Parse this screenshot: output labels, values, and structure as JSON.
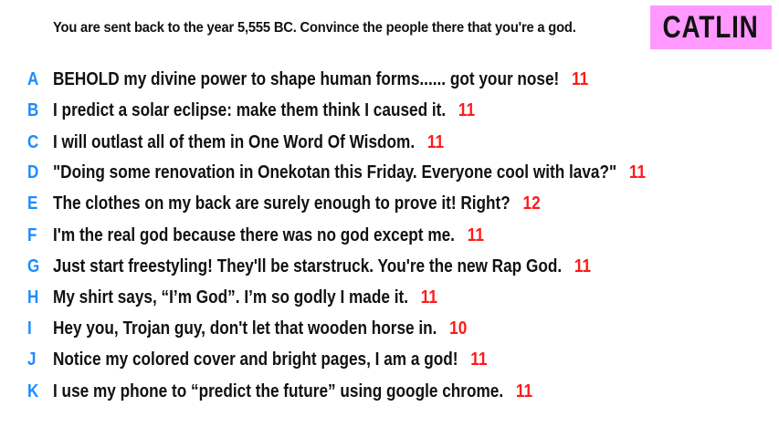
{
  "prompt": "You are sent back to the year 5,555 BC. Convince the people there that you're a god.",
  "player": {
    "name": "CATLIN",
    "badge_color": "#ff99ff"
  },
  "colors": {
    "letter": "#1a8cff",
    "score": "#ff1a1a",
    "text": "#111111"
  },
  "answers": [
    {
      "letter": "A",
      "text": "BEHOLD my divine power to shape human forms...... got your nose!",
      "score": "11"
    },
    {
      "letter": "B",
      "text": "I predict a solar eclipse: make them think I caused it.",
      "score": "11"
    },
    {
      "letter": "C",
      "text": "I will outlast all of them in One Word Of Wisdom.",
      "score": "11"
    },
    {
      "letter": "D",
      "text": "\"Doing some renovation in Onekotan this Friday. Everyone cool with lava?\"",
      "score": "11"
    },
    {
      "letter": "E",
      "text": "The clothes on my back are surely enough to prove it! Right?",
      "score": "12"
    },
    {
      "letter": "F",
      "text": "I'm the real god because there was no god except me.",
      "score": "11"
    },
    {
      "letter": "G",
      "text": "Just start freestyling! They'll be starstruck. You're the new Rap God.",
      "score": "11"
    },
    {
      "letter": "H",
      "text": "My shirt says, “I’m God”. I’m so godly I made it.",
      "score": "11"
    },
    {
      "letter": "I",
      "text": "Hey you, Trojan guy, don't let that wooden horse in.",
      "score": "10"
    },
    {
      "letter": "J",
      "text": "Notice my colored cover and bright pages, I am a god!",
      "score": "11"
    },
    {
      "letter": "K",
      "text": "I use my phone to “predict the future” using google chrome.",
      "score": "11"
    }
  ]
}
